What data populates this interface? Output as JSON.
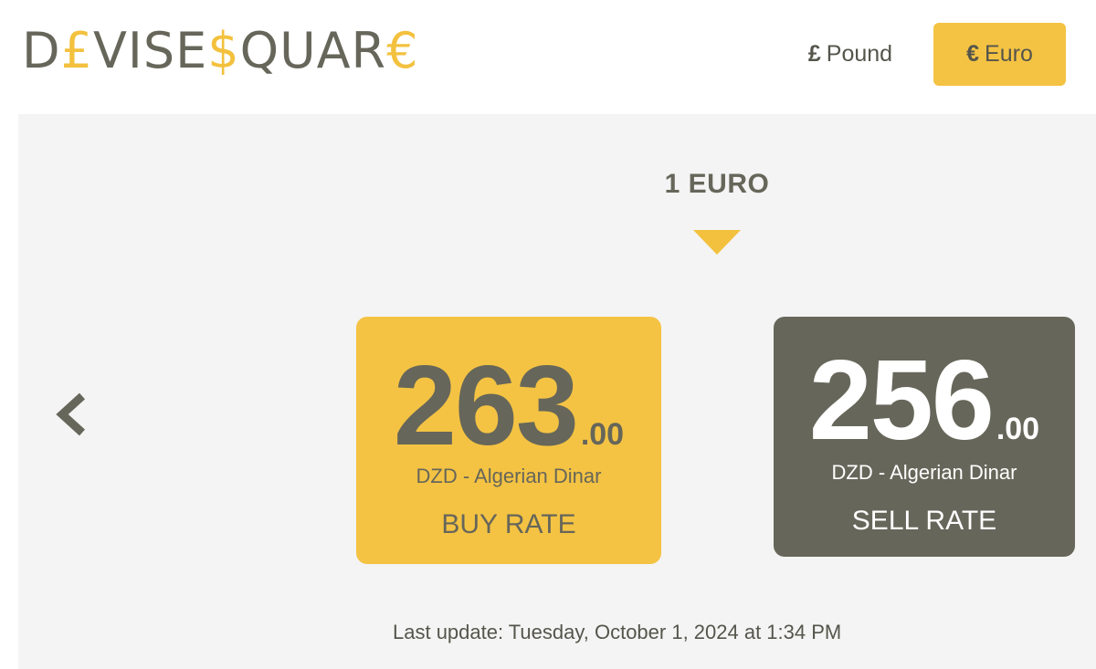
{
  "logo": {
    "segments": [
      {
        "text": "D",
        "accent": false
      },
      {
        "text": "£",
        "accent": true
      },
      {
        "text": "VISE",
        "accent": false
      },
      {
        "text": "$",
        "accent": true
      },
      {
        "text": "QUAR",
        "accent": false
      },
      {
        "text": "€",
        "accent": true
      }
    ]
  },
  "currency_switch": {
    "pound": {
      "symbol": "£",
      "label": "Pound"
    },
    "euro": {
      "symbol": "€",
      "label": "Euro",
      "selected": true
    }
  },
  "base": {
    "label": "1 EURO"
  },
  "buy": {
    "value_int": "263",
    "value_dec": ".00",
    "currency": "DZD - Algerian Dinar",
    "label": "BUY RATE"
  },
  "sell": {
    "value_int": "256",
    "value_dec": ".00",
    "currency": "DZD - Algerian Dinar",
    "label": "SELL RATE"
  },
  "last_update": "Last update: Tuesday, October 1, 2024 at 1:34 PM",
  "icons": {
    "prev": "chevron-left-icon",
    "arrow": "caret-down-icon"
  },
  "colors": {
    "accent": "#f3c13e",
    "dark": "#66665a",
    "panel": "#f4f4f4"
  }
}
